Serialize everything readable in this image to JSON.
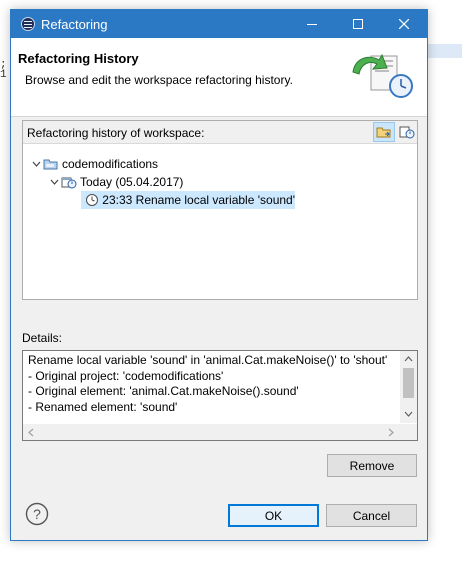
{
  "background": {
    "left_text": ";\n1"
  },
  "window": {
    "title": "Refactoring"
  },
  "banner": {
    "title": "Refactoring History",
    "description": "Browse and edit the workspace refactoring history."
  },
  "history": {
    "label": "Refactoring history of workspace:",
    "tree": {
      "project": "codemodifications",
      "date_group": "Today (05.04.2017)",
      "entry": "23:33 Rename local variable 'sound'"
    }
  },
  "details": {
    "label": "Details:",
    "lines": [
      "Rename local variable 'sound' in 'animal.Cat.makeNoise()' to 'shout'",
      "- Original project: 'codemodifications'",
      "- Original element: 'animal.Cat.makeNoise().sound'",
      "- Renamed element: 'sound'"
    ]
  },
  "buttons": {
    "remove": "Remove",
    "ok": "OK",
    "cancel": "Cancel"
  },
  "colors": {
    "titlebar": "#2b78c5",
    "selection": "#cce8ff",
    "default_button_border": "#0078d7"
  }
}
